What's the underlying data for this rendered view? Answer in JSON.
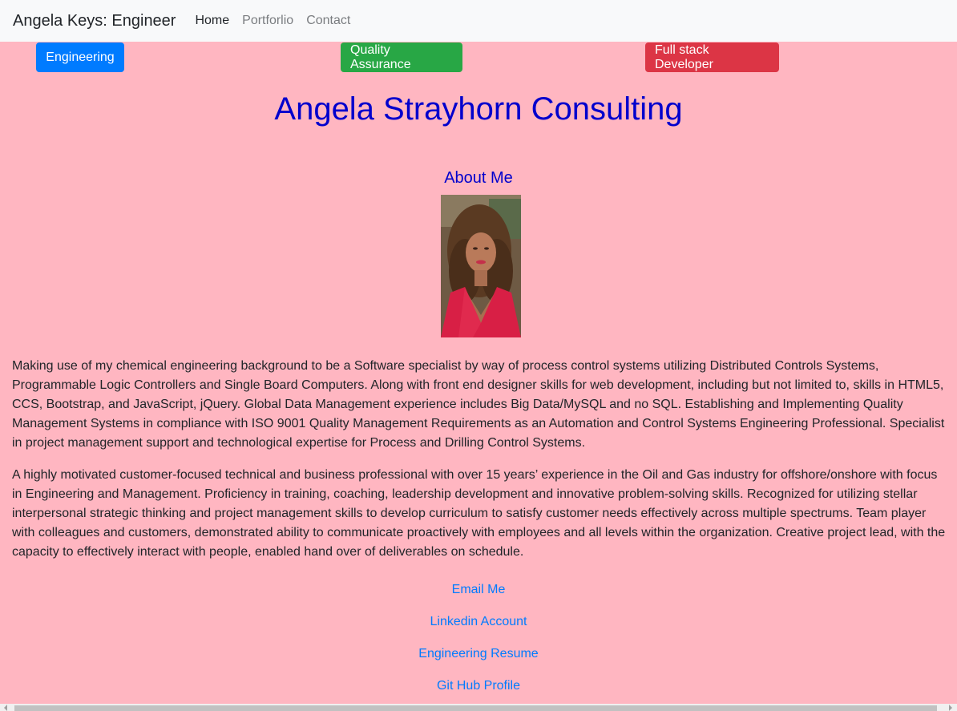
{
  "navbar": {
    "brand": "Angela Keys: Engineer",
    "links": [
      "Home",
      "Portforlio",
      "Contact"
    ]
  },
  "buttons": {
    "engineering": "Engineering",
    "quality_assurance": "Quality Assurance",
    "full_stack": "Full stack Developer"
  },
  "colors": {
    "background": "#ffb6c1",
    "heading": "#0000cd",
    "link": "#007bff",
    "btn_primary": "#007bff",
    "btn_success": "#28a745",
    "btn_danger": "#dc3545"
  },
  "main": {
    "title": "Angela Strayhorn Consulting",
    "about_heading": "About Me",
    "paragraphs": [
      "Making use of my chemical engineering background to be a Software specialist by way of process control systems utilizing Distributed Controls Systems, Programmable Logic Controllers and Single Board Computers. Along with front end designer skills for web development, including but not limited to, skills in HTML5, CCS, Bootstrap, and JavaScript, jQuery. Global Data Management experience includes Big Data/MySQL and no SQL. Establishing and Implementing Quality Management Systems in compliance with ISO 9001 Quality Management Requirements as an Automation and Control Systems Engineering Professional. Specialist in project management support and technological expertise for Process and Drilling Control Systems.",
      "A highly motivated customer-focused technical and business professional with over 15 years’ experience in the Oil and Gas industry for offshore/onshore with focus in Engineering and Management. Proficiency in training, coaching, leadership development and innovative problem-solving skills. Recognized for utilizing stellar interpersonal strategic thinking and project management skills to develop curriculum to satisfy customer needs effectively across multiple spectrums. Team player with colleagues and customers, demonstrated ability to communicate proactively with employees and all levels within the organization. Creative project lead, with the capacity to effectively interact with people, enabled hand over of deliverables on schedule."
    ],
    "links": [
      "Email Me",
      "Linkedin Account",
      "Engineering Resume",
      "Git Hub Profile"
    ]
  }
}
